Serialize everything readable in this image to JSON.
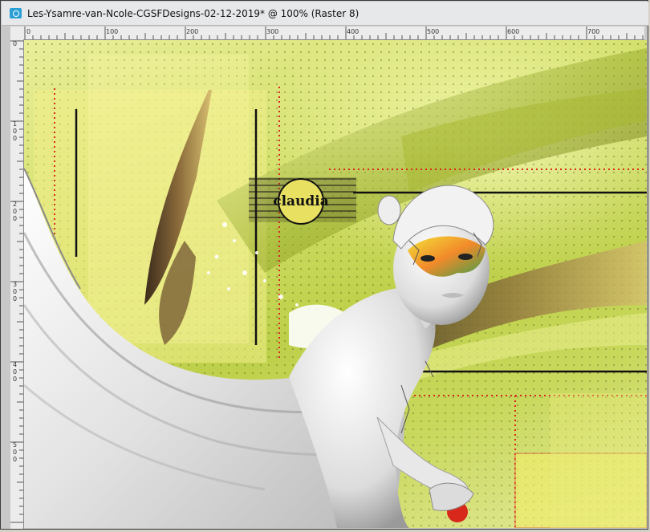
{
  "window": {
    "title": "Les-Ysamre-van-Ncole-CGSFDesigns-02-12-2019* @ 100% (Raster 8)"
  },
  "rulers": {
    "horizontal_ticks": [
      "0",
      "100",
      "200",
      "300",
      "400",
      "500",
      "600",
      "700"
    ],
    "vertical_ticks": [
      "0",
      "1\n0\n0",
      "2\n0\n0",
      "3\n0\n0",
      "4\n0\n0",
      "5\n0\n0"
    ]
  },
  "artwork": {
    "watermark_text": "claudia"
  },
  "colors": {
    "accent_red": "#d8281c",
    "line_dark": "#111111",
    "canvas_green": "#c8d85c"
  }
}
